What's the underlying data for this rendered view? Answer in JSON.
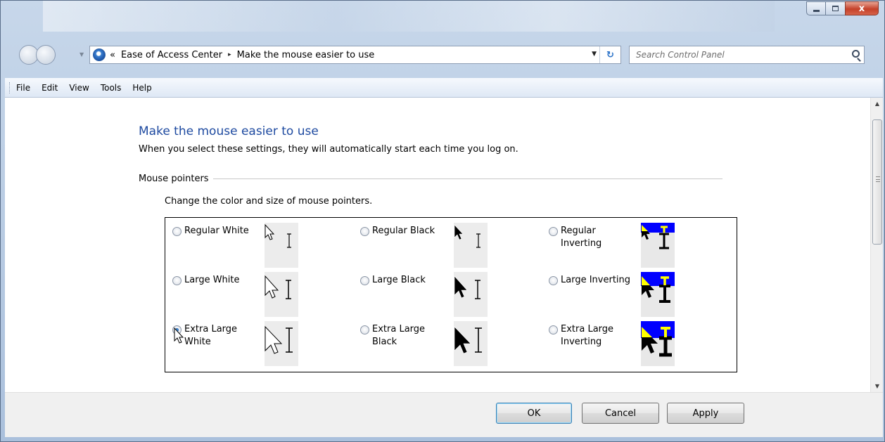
{
  "window": {
    "controls": {
      "minimize_icon": "minimize-icon",
      "maximize_icon": "maximize-icon",
      "close_label": "x"
    }
  },
  "nav": {
    "breadcrumb_prefix": "«",
    "breadcrumbs": [
      "Ease of Access Center",
      "Make the mouse easier to use"
    ],
    "breadcrumb_separator": "▸",
    "search_placeholder": "Search Control Panel"
  },
  "menu": [
    "File",
    "Edit",
    "View",
    "Tools",
    "Help"
  ],
  "page": {
    "title": "Make the mouse easier to use",
    "subtitle": "When you select these settings, they will automatically start each time you log on.",
    "section": {
      "heading": "Mouse pointers",
      "description": "Change the color and size of mouse pointers."
    },
    "pointer_options": [
      {
        "label": "Regular White",
        "selected": false
      },
      {
        "label": "Regular Black",
        "selected": false
      },
      {
        "label": "Regular Inverting",
        "selected": false
      },
      {
        "label": "Large White",
        "selected": false
      },
      {
        "label": "Large Black",
        "selected": false
      },
      {
        "label": "Large Inverting",
        "selected": false
      },
      {
        "label": "Extra Large White",
        "selected": true
      },
      {
        "label": "Extra Large Black",
        "selected": false
      },
      {
        "label": "Extra Large Inverting",
        "selected": false
      }
    ]
  },
  "footer": {
    "ok": "OK",
    "cancel": "Cancel",
    "apply": "Apply"
  },
  "colors": {
    "title_blue": "#1e4aa0",
    "inverting_blue": "#0000ff",
    "inverting_yellow": "#ffff00"
  }
}
